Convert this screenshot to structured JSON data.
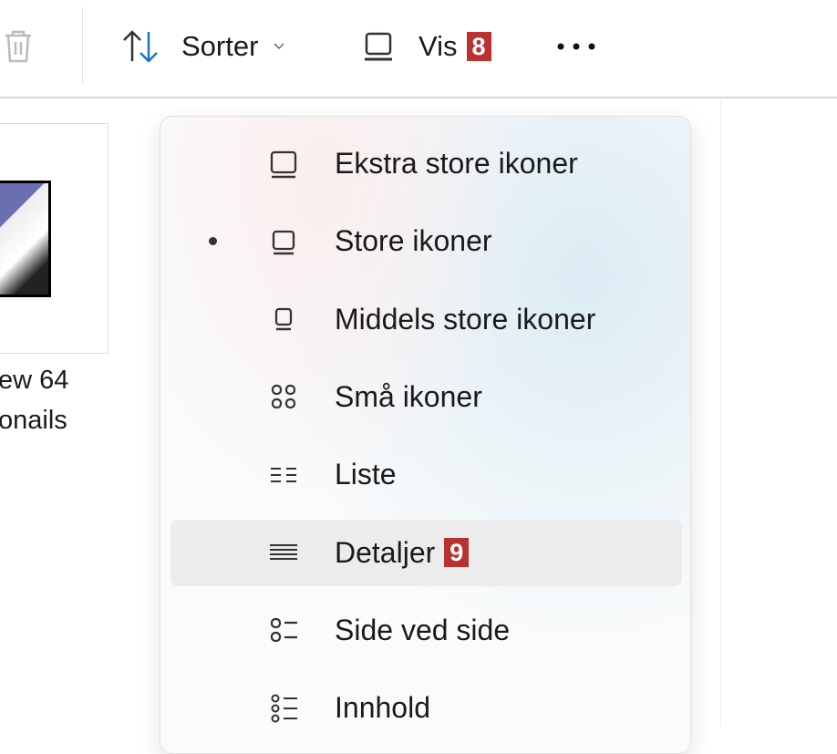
{
  "toolbar": {
    "sort_label": "Sorter",
    "view_label": "Vis",
    "view_badge": "8"
  },
  "file": {
    "name_line1": "ew 64",
    "name_line2": "onails"
  },
  "menu": {
    "items": [
      {
        "label": "Ekstra store ikoner",
        "icon": "monitor-large-icon"
      },
      {
        "label": "Store ikoner",
        "icon": "monitor-icon",
        "selected": true
      },
      {
        "label": "Middels store ikoner",
        "icon": "monitor-small-icon"
      },
      {
        "label": "Små ikoner",
        "icon": "grid-icon"
      },
      {
        "label": "Liste",
        "icon": "list-icon"
      },
      {
        "label": "Detaljer",
        "icon": "details-icon",
        "badge": "9"
      },
      {
        "label": "Side ved side",
        "icon": "tiles-icon"
      },
      {
        "label": "Innhold",
        "icon": "content-icon"
      }
    ]
  },
  "colors": {
    "badge": "#b83232",
    "accent": "#1a73c8"
  }
}
